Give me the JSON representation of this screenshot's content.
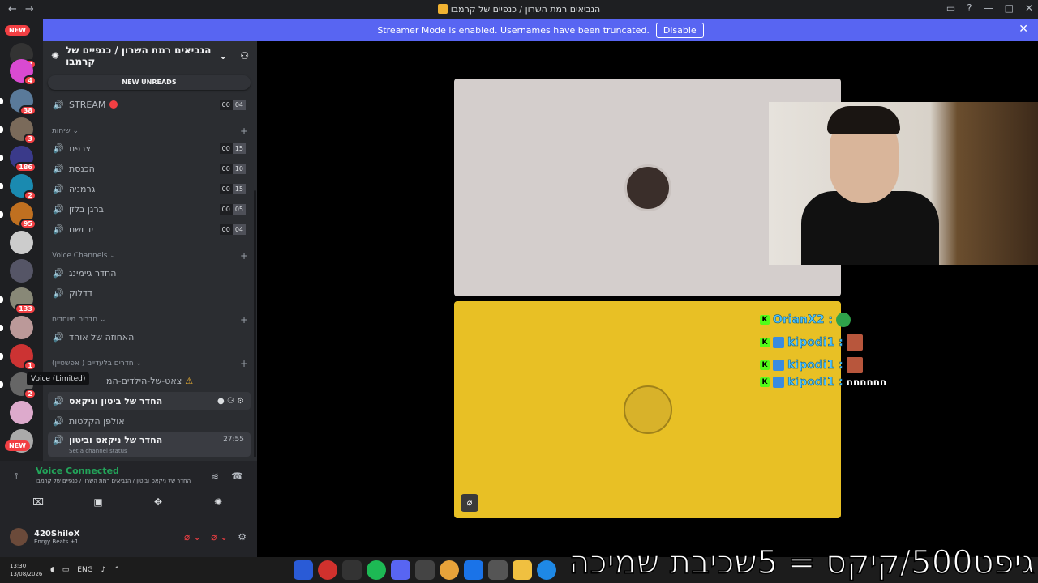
{
  "window": {
    "title": "הנביאים רמת השרון / כנפיים של קרמבו"
  },
  "banner": {
    "text": "Streamer Mode is enabled. Usernames have been truncated.",
    "button": "Disable"
  },
  "servers": {
    "new_top": "NEW",
    "new_bottom": "NEW",
    "badges": [
      "2",
      "4",
      "38",
      "3",
      "186",
      "2",
      "95",
      "133",
      "1",
      "2"
    ]
  },
  "guild": {
    "name": "הנביאים רמת השרון / כנפיים של קרמבו"
  },
  "new_unreads": "NEW UNREADS",
  "channels": {
    "stream": {
      "name": "STREAM",
      "c1": "00",
      "c2": "04"
    },
    "cat_talk": "שיחות",
    "talk": [
      {
        "name": "צרפת",
        "c1": "00",
        "c2": "15"
      },
      {
        "name": "הכנסת",
        "c1": "00",
        "c2": "10"
      },
      {
        "name": "גרמניה",
        "c1": "00",
        "c2": "15"
      },
      {
        "name": "ברגן בלזן",
        "c1": "00",
        "c2": "05"
      },
      {
        "name": "יד ושם",
        "c1": "00",
        "c2": "04"
      }
    ],
    "cat_voice": "Voice Channels",
    "voice": [
      "החדר גיימינג",
      "דדלוק"
    ],
    "cat_special": "חדרים מיוחדים",
    "special": [
      "האחוזה של אוהד"
    ],
    "cat_epstein": "חדרים בלעדיים ( אפשטיין)",
    "epstein_first": "צאט-של-הילדים-המ",
    "epstein": [
      "החדר של ביטון וניקאס",
      "אולפן הקלטות"
    ],
    "current": {
      "name": "החדר של ניקאס וביטון",
      "timer": "27:55",
      "status": "Set a channel status"
    }
  },
  "tooltip": "Voice (Limited)",
  "voice": {
    "title": "Voice Connected",
    "sub": "החדר של ניקאס וביטון / הנביאים רמת השרון / כנפיים של קרמבו"
  },
  "user": {
    "name": "420ShiloX",
    "status": "Enrgy Beats +1"
  },
  "chat": [
    {
      "user": "OrianX2 :",
      "msg": ""
    },
    {
      "user": "kipodi1 :",
      "msg": ""
    },
    {
      "user": "kipodi1 :",
      "msg": ""
    },
    {
      "user": "kipodi1 :",
      "msg": "חחחחחח"
    }
  ],
  "taskbar": {
    "time": "13:30",
    "date": "13/08/2026",
    "lang": "ENG"
  },
  "overlay": "גיפט500/קיקס = 5שכיבת שמיכה"
}
